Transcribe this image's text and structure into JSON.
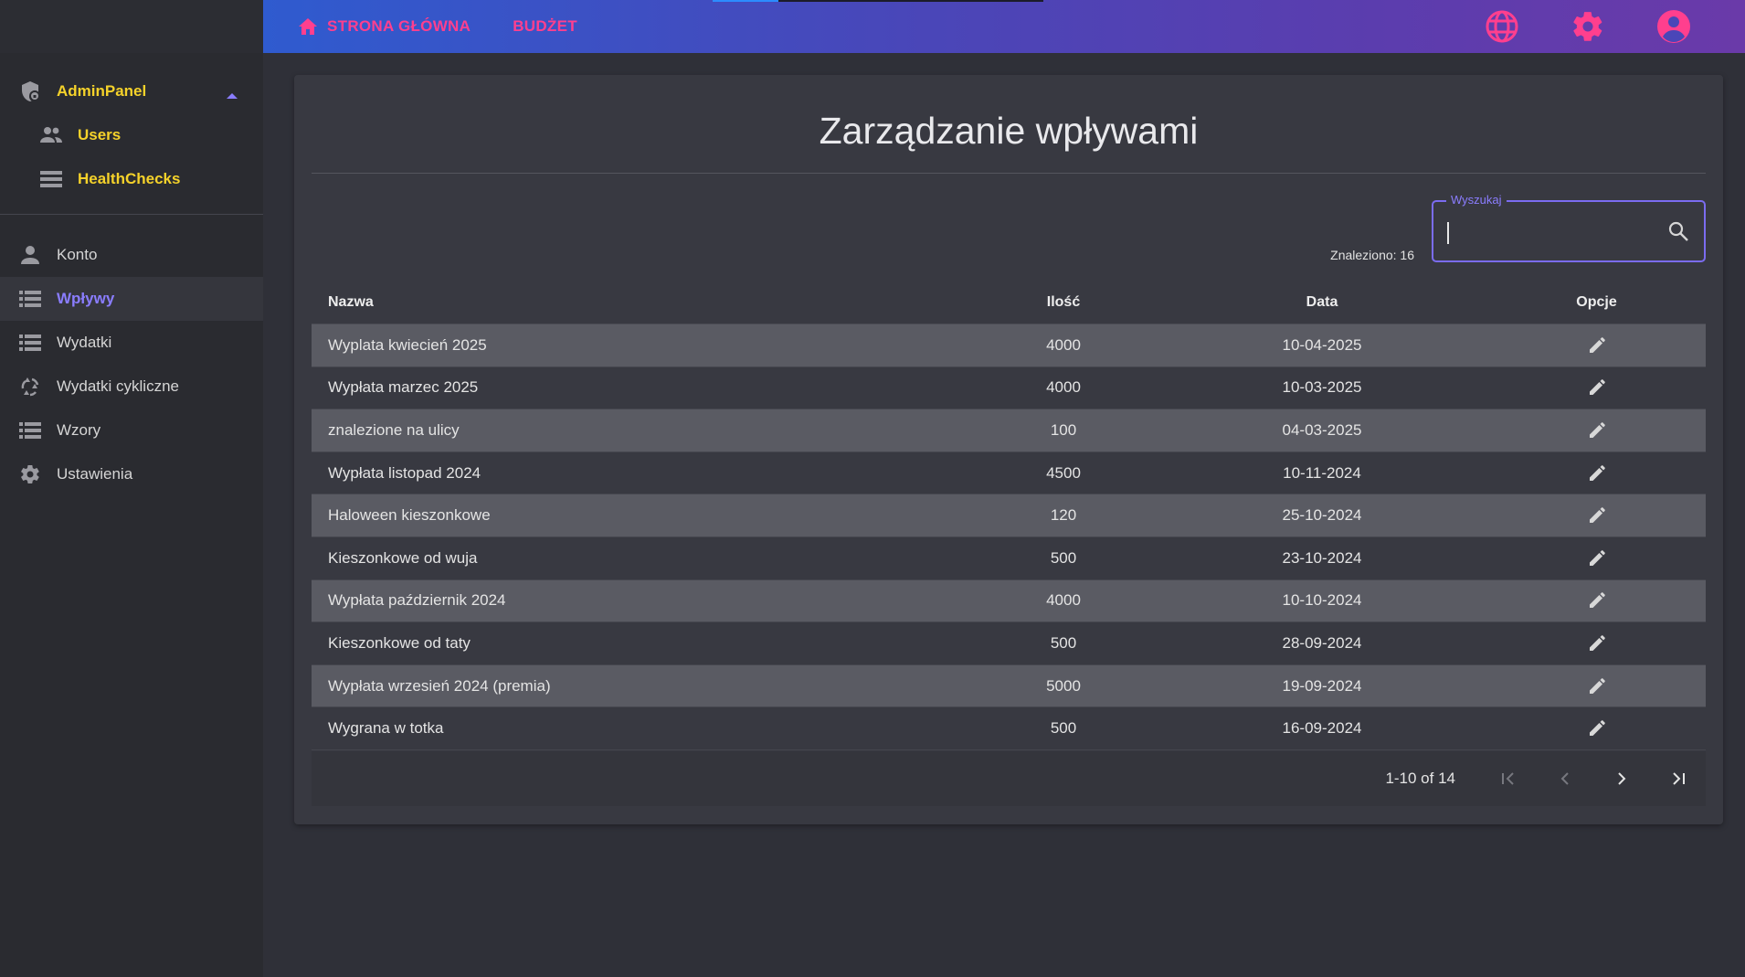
{
  "topbar": {
    "home_label": "STRONA GŁÓWNA",
    "budget_label": "BUDŻET",
    "icons": [
      "globe-icon",
      "gear-icon",
      "account-circle-icon"
    ]
  },
  "sidebar": {
    "admin": {
      "label": "AdminPanel",
      "children": [
        {
          "label": "Users",
          "icon": "people-icon"
        },
        {
          "label": "HealthChecks",
          "icon": "list-icon"
        }
      ]
    },
    "items": [
      {
        "label": "Konto",
        "icon": "person-icon",
        "active": false
      },
      {
        "label": "Wpływy",
        "icon": "list-icon",
        "active": true
      },
      {
        "label": "Wydatki",
        "icon": "list-icon",
        "active": false
      },
      {
        "label": "Wydatki cykliczne",
        "icon": "recycle-icon",
        "active": false
      },
      {
        "label": "Wzory",
        "icon": "list-icon",
        "active": false
      },
      {
        "label": "Ustawienia",
        "icon": "gear-icon",
        "active": false
      }
    ]
  },
  "main": {
    "title": "Zarządzanie wpływami",
    "found_text": "Znaleziono: 16",
    "search": {
      "label": "Wyszukaj",
      "value": "",
      "placeholder": ""
    }
  },
  "table": {
    "headers": {
      "name": "Nazwa",
      "qty": "Ilość",
      "date": "Data",
      "options": "Opcje"
    },
    "rows": [
      {
        "name": "Wyplata kwiecień 2025",
        "qty": "4000",
        "date": "10-04-2025"
      },
      {
        "name": "Wypłata marzec 2025",
        "qty": "4000",
        "date": "10-03-2025"
      },
      {
        "name": "znalezione na ulicy",
        "qty": "100",
        "date": "04-03-2025"
      },
      {
        "name": "Wypłata listopad 2024",
        "qty": "4500",
        "date": "10-11-2024"
      },
      {
        "name": "Haloween kieszonkowe",
        "qty": "120",
        "date": "25-10-2024"
      },
      {
        "name": "Kieszonkowe od wuja",
        "qty": "500",
        "date": "23-10-2024"
      },
      {
        "name": "Wypłata październik 2024",
        "qty": "4000",
        "date": "10-10-2024"
      },
      {
        "name": "Kieszonkowe od taty",
        "qty": "500",
        "date": "28-09-2024"
      },
      {
        "name": "Wypłata wrzesień 2024 (premia)",
        "qty": "5000",
        "date": "19-09-2024"
      },
      {
        "name": "Wygrana w totka",
        "qty": "500",
        "date": "16-09-2024"
      }
    ]
  },
  "paginator": {
    "range": "1-10 of 14"
  },
  "colors": {
    "accent_pink": "#ff3f8e",
    "accent_yellow": "#f5d22a",
    "accent_purple": "#8a7dff",
    "row_alt": "#5a5b63"
  }
}
